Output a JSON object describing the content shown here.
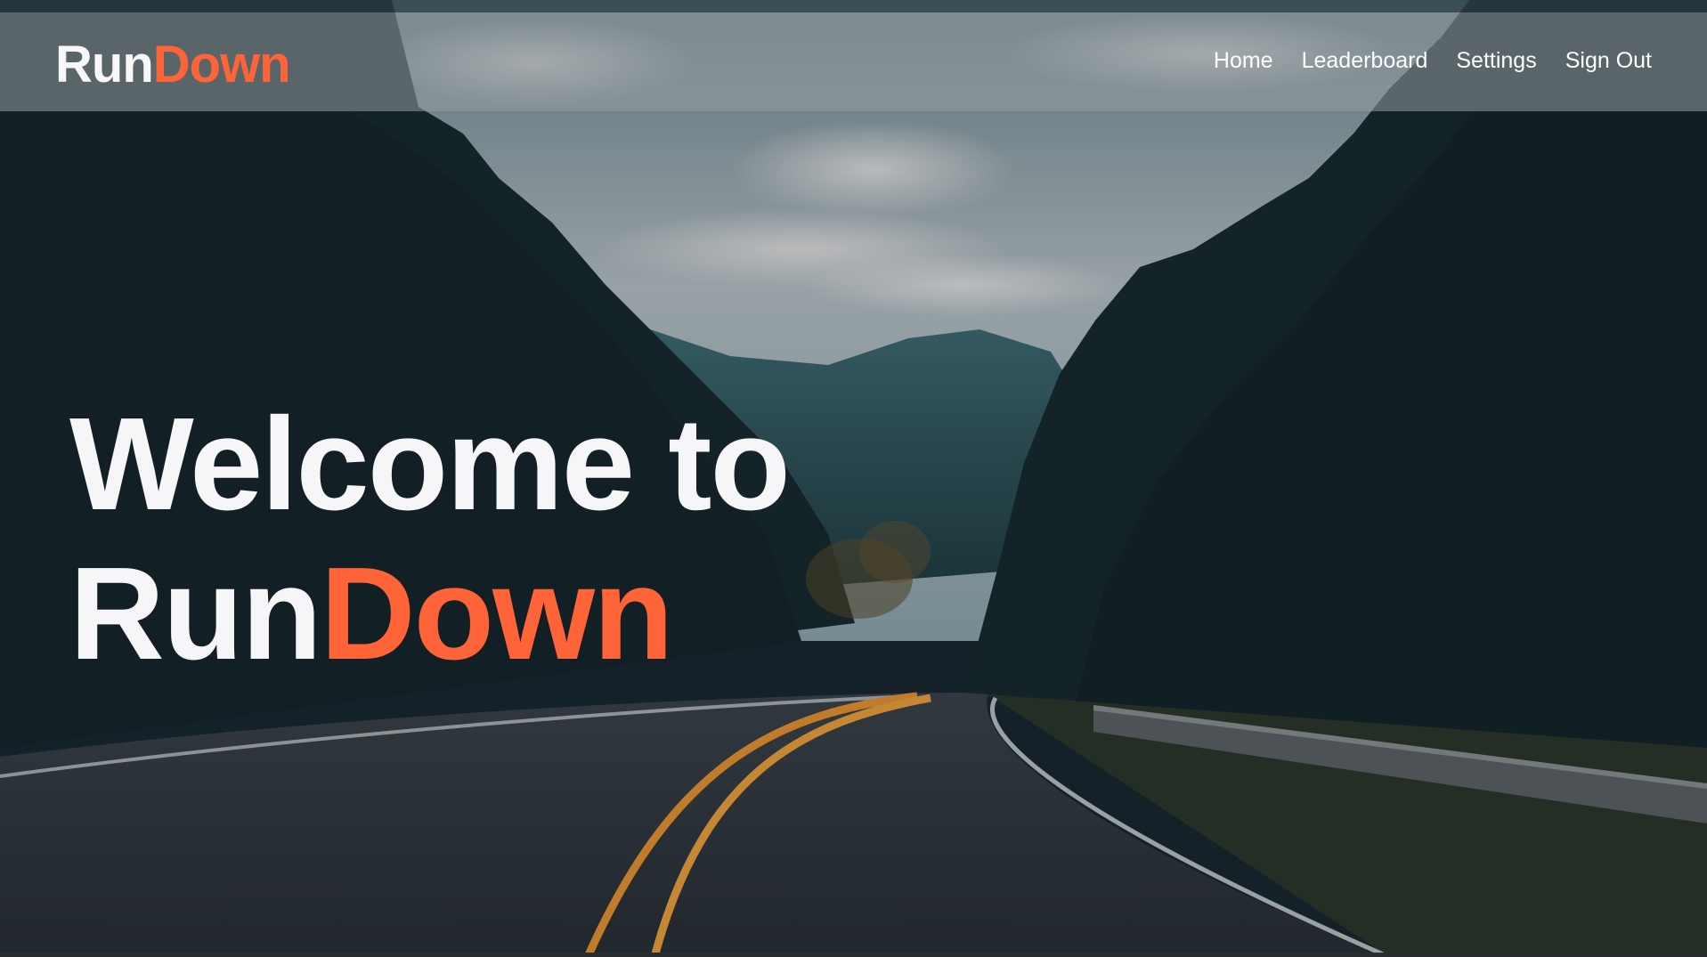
{
  "brand": {
    "part1": "Run",
    "part2": "Down"
  },
  "nav": {
    "links": [
      {
        "label": "Home"
      },
      {
        "label": "Leaderboard"
      },
      {
        "label": "Settings"
      },
      {
        "label": "Sign Out"
      }
    ]
  },
  "hero": {
    "line1": "Welcome to",
    "line2_part1": "Run",
    "line2_part2": "Down",
    "background": "mountain-road-photo"
  },
  "colors": {
    "accent": "#ff6338",
    "text": "#f6f5f7",
    "navbar": "rgba(150,158,162,0.55)"
  }
}
